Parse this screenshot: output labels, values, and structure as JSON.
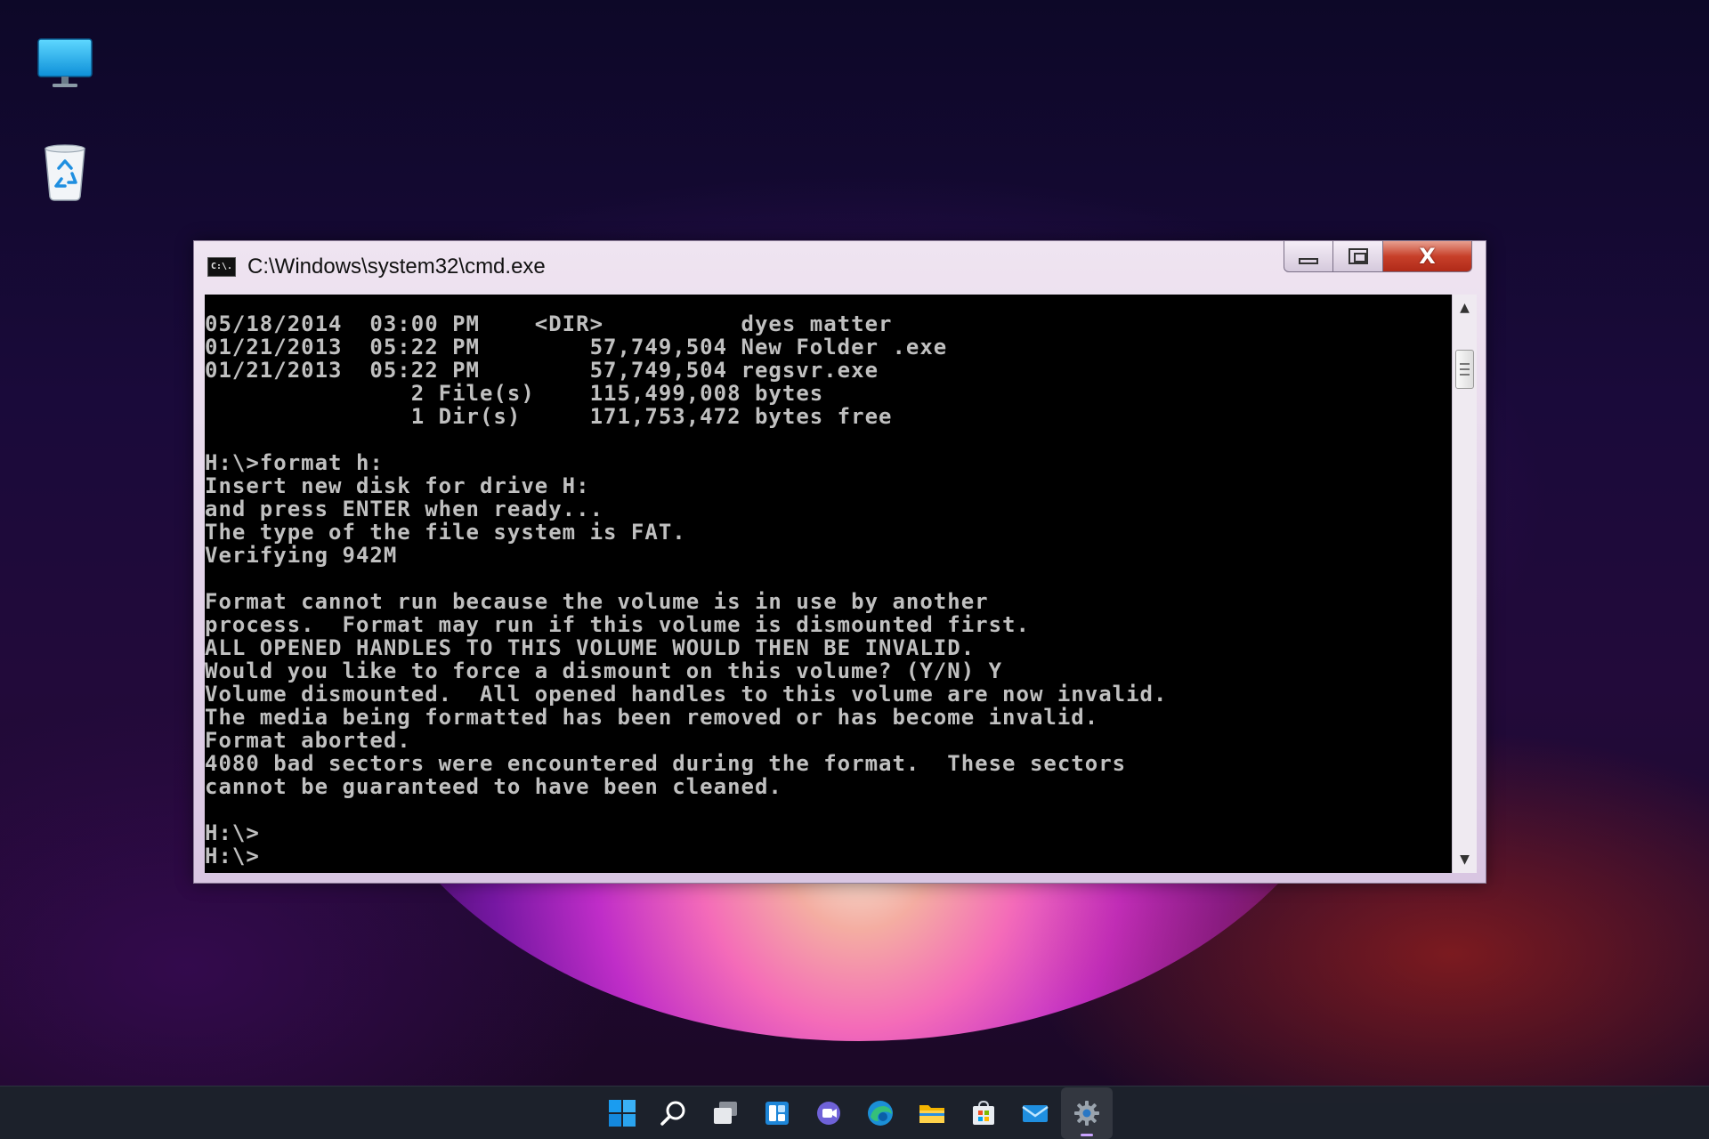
{
  "desktop": {
    "icons": [
      {
        "name": "this-pc"
      },
      {
        "name": "recycle-bin"
      }
    ]
  },
  "window": {
    "title": "C:\\Windows\\system32\\cmd.exe",
    "app_icon_text": "C:\\.",
    "close_glyph": "X",
    "console_lines": "05/18/2014  03:00 PM    <DIR>          dyes matter\n01/21/2013  05:22 PM        57,749,504 New Folder .exe\n01/21/2013  05:22 PM        57,749,504 regsvr.exe\n               2 File(s)    115,499,008 bytes\n               1 Dir(s)     171,753,472 bytes free\n\nH:\\>format h:\nInsert new disk for drive H:\nand press ENTER when ready...\nThe type of the file system is FAT.\nVerifying 942M\n\nFormat cannot run because the volume is in use by another\nprocess.  Format may run if this volume is dismounted first.\nALL OPENED HANDLES TO THIS VOLUME WOULD THEN BE INVALID.\nWould you like to force a dismount on this volume? (Y/N) Y\nVolume dismounted.  All opened handles to this volume are now invalid.\nThe media being formatted has been removed or has become invalid.\nFormat aborted.\n4080 bad sectors were encountered during the format.  These sectors\ncannot be guaranteed to have been cleaned.\n\nH:\\>\nH:\\>",
    "colors": {
      "console_bg": "#000000",
      "console_fg": "#c0c0c0",
      "close_button": "#c7402a"
    }
  },
  "taskbar": {
    "icons": [
      "start-icon",
      "search-icon",
      "task-view-icon",
      "widgets-icon",
      "chat-icon",
      "edge-icon",
      "file-explorer-icon",
      "store-icon",
      "mail-icon",
      "settings-icon"
    ],
    "active": "settings-icon"
  }
}
